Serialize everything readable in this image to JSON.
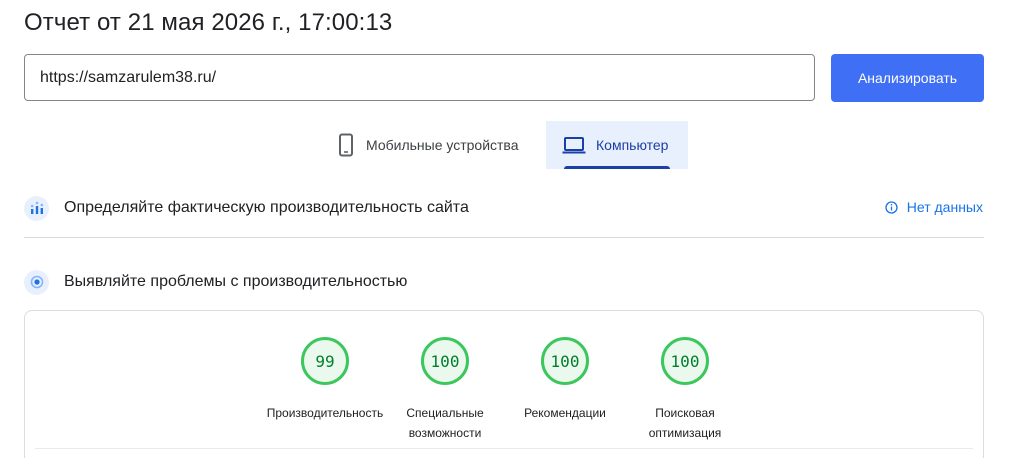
{
  "header": {
    "title": "Отчет от 21 мая 2026 г., 17:00:13"
  },
  "url_input": {
    "value": "https://samzarulem38.ru/"
  },
  "analyze_button": {
    "label": "Анализировать"
  },
  "device_tabs": [
    {
      "label": "Мобильные устройства",
      "icon": "smartphone-icon",
      "selected": false
    },
    {
      "label": "Компьютер",
      "icon": "laptop-icon",
      "selected": true
    }
  ],
  "field_data": {
    "title": "Определяйте фактическую производительность сайта",
    "status": "Нет данных",
    "status_icon": "info-icon"
  },
  "lab_data": {
    "title": "Выявляйте проблемы с производительностью"
  },
  "scores": [
    {
      "value": "99",
      "label_line1": "Производительность",
      "label_line2": ""
    },
    {
      "value": "100",
      "label_line1": "Специальные",
      "label_line2": "возможности"
    },
    {
      "value": "100",
      "label_line1": "Рекомендации",
      "label_line2": ""
    },
    {
      "value": "100",
      "label_line1": "Поисковая",
      "label_line2": "оптимизация"
    }
  ],
  "colors": {
    "accent": "#3f6ff4",
    "selected_tab_bg": "#e8f0fe",
    "score_good": "#3cc75d",
    "score_good_text": "#00802b",
    "link": "#1a73e8"
  }
}
